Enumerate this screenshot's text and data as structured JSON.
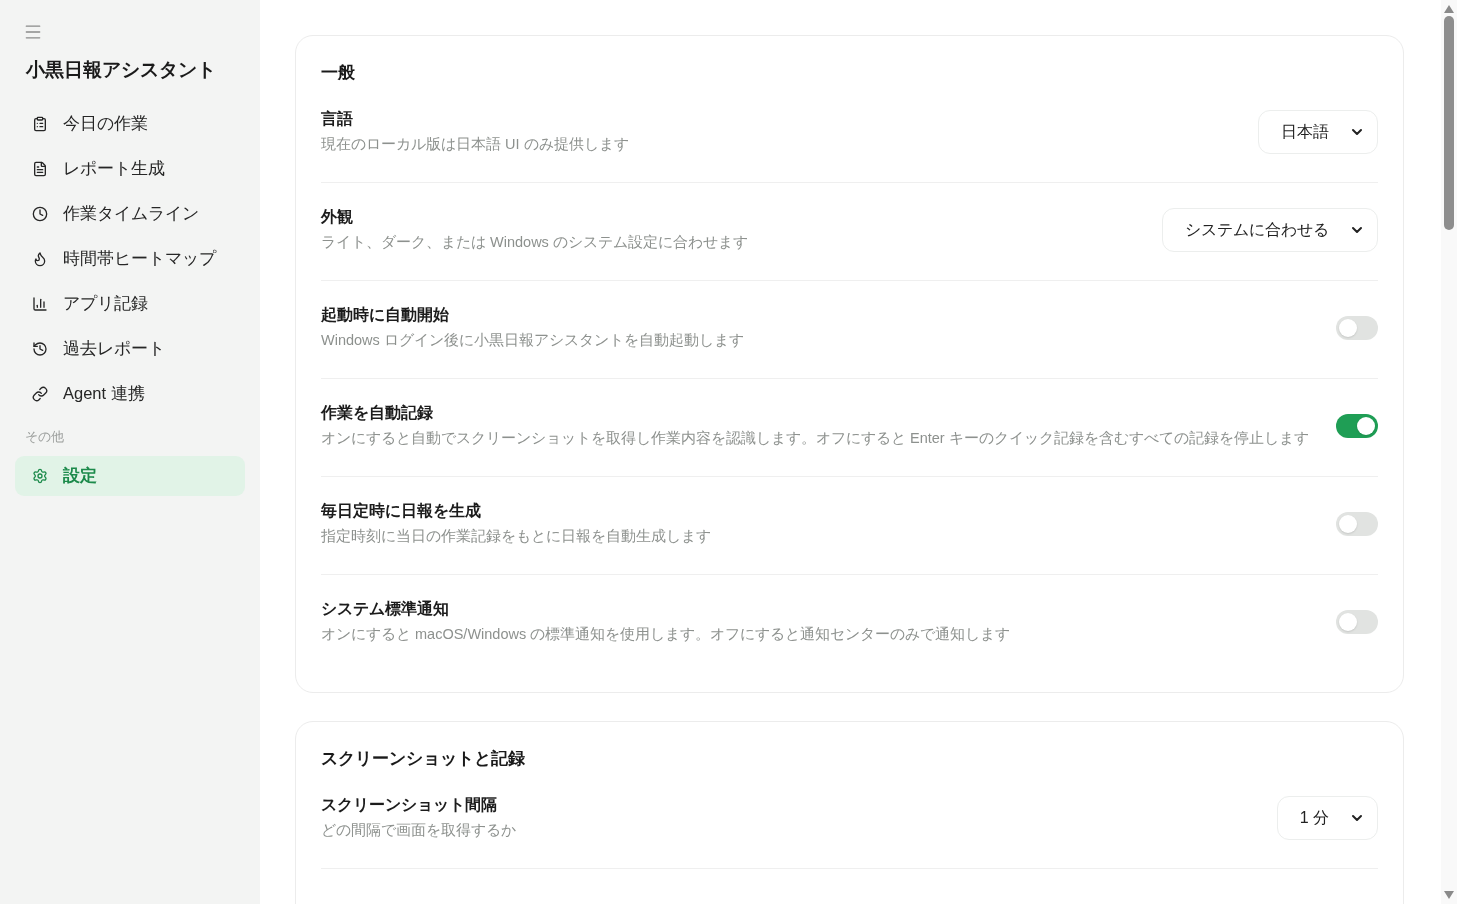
{
  "sidebar": {
    "app_title": "小黒日報アシスタント",
    "nav_items": [
      {
        "label": "今日の作業",
        "selected": false
      },
      {
        "label": "レポート生成",
        "selected": false
      },
      {
        "label": "作業タイムライン",
        "selected": false
      },
      {
        "label": "時間帯ヒートマップ",
        "selected": false
      },
      {
        "label": "アプリ記録",
        "selected": false
      },
      {
        "label": "過去レポート",
        "selected": false
      },
      {
        "label": "Agent 連携",
        "selected": false
      }
    ],
    "section_label": "その他",
    "other_items": [
      {
        "label": "設定",
        "selected": true
      }
    ]
  },
  "settings_sections": [
    {
      "title": "一般",
      "rows": [
        {
          "kind": "select",
          "label": "言語",
          "description": "現在のローカル版は日本語 UI のみ提供します",
          "value": "日本語"
        },
        {
          "kind": "select",
          "label": "外観",
          "description": "ライト、ダーク、または Windows のシステム設定に合わせます",
          "value": "システムに合わせる"
        },
        {
          "kind": "toggle",
          "label": "起動時に自動開始",
          "description": "Windows ログイン後に小黒日報アシスタントを自動起動します",
          "on": false
        },
        {
          "kind": "toggle",
          "label": "作業を自動記録",
          "description": "オンにすると自動でスクリーンショットを取得し作業内容を認識します。オフにすると Enter キーのクイック記録を含むすべての記録を停止します",
          "on": true
        },
        {
          "kind": "toggle",
          "label": "毎日定時に日報を生成",
          "description": "指定時刻に当日の作業記録をもとに日報を自動生成します",
          "on": false
        },
        {
          "kind": "toggle",
          "label": "システム標準通知",
          "description": "オンにすると macOS/Windows の標準通知を使用します。オフにすると通知センターのみで通知します",
          "on": false
        }
      ]
    },
    {
      "title": "スクリーンショットと記録",
      "rows": [
        {
          "kind": "select",
          "label": "スクリーンショット間隔",
          "description": "どの間隔で画面を取得するか",
          "value": "1 分"
        }
      ]
    }
  ]
}
